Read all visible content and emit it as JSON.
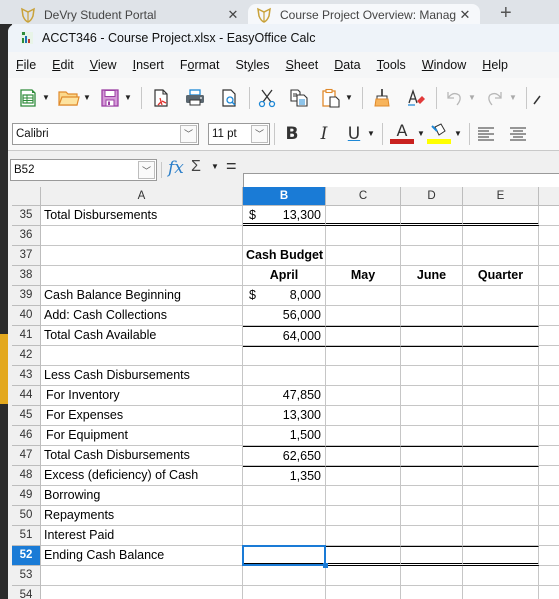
{
  "browser": {
    "tabs": [
      {
        "label": "DeVry Student Portal",
        "icon": "devry-shield-icon",
        "active": false
      },
      {
        "label": "Course Project Overview: Manage",
        "icon": "devry-shield-icon",
        "active": true
      }
    ],
    "new_tab_label": "+",
    "close_glyph": "✕"
  },
  "app": {
    "title": "ACCT346 - Course Project.xlsx - EasyOffice Calc",
    "menu": [
      {
        "label": "File",
        "accel": "F",
        "rest": "ile"
      },
      {
        "label": "Edit",
        "accel": "E",
        "rest": "dit"
      },
      {
        "label": "View",
        "accel": "V",
        "rest": "iew"
      },
      {
        "label": "Insert",
        "accel": "I",
        "rest": "nsert"
      },
      {
        "label": "Format",
        "pre": "F",
        "accel": "o",
        "rest": "rmat"
      },
      {
        "label": "Styles",
        "pre": "St",
        "accel": "y",
        "rest": "les"
      },
      {
        "label": "Sheet",
        "accel": "S",
        "rest": "heet"
      },
      {
        "label": "Data",
        "accel": "D",
        "rest": "ata"
      },
      {
        "label": "Tools",
        "accel": "T",
        "rest": "ools"
      },
      {
        "label": "Window",
        "accel": "W",
        "rest": "indow"
      },
      {
        "label": "Help",
        "accel": "H",
        "rest": "elp"
      }
    ],
    "toolbar": [
      "new-spreadsheet-icon",
      "open-folder-icon",
      "save-icon",
      "export-pdf-icon",
      "print-icon",
      "print-preview-icon",
      "cut-icon",
      "copy-icon",
      "paste-icon",
      "clone-formatting-icon",
      "clear-formatting-icon",
      "undo-icon",
      "redo-icon"
    ],
    "format": {
      "font_name": "Calibri",
      "font_size": "11 pt",
      "bold": "B",
      "italic": "I",
      "underline": "U",
      "font_color_glyph": "A",
      "font_color": "#c9211e",
      "highlight_color": "#ffff00"
    },
    "formula_bar": {
      "name_box": "B52",
      "fx": "fx",
      "sigma": "Σ",
      "equals": "=",
      "content": ""
    }
  },
  "sheet": {
    "columns": [
      "A",
      "B",
      "C",
      "D",
      "E"
    ],
    "selected_column": "B",
    "selected_cell": "B52",
    "rows": [
      {
        "num": "35",
        "a": "Total Disbursements",
        "b_cur": "$",
        "b": "13,300"
      },
      {
        "num": "36",
        "a": "",
        "b": ""
      },
      {
        "num": "37",
        "a": "",
        "b": "Cash Budget"
      },
      {
        "num": "38",
        "a": "",
        "b": "April",
        "c": "May",
        "d": "June",
        "e": "Quarter"
      },
      {
        "num": "39",
        "a": "Cash Balance Beginning",
        "b_cur": "$",
        "b": "8,000"
      },
      {
        "num": "40",
        "a": "Add: Cash Collections",
        "b": "56,000"
      },
      {
        "num": "41",
        "a": "Total Cash Available",
        "b": "64,000"
      },
      {
        "num": "42",
        "a": "",
        "b": ""
      },
      {
        "num": "43",
        "a": "Less Cash Disbursements",
        "b": ""
      },
      {
        "num": "44",
        "a": "For Inventory",
        "b": "47,850"
      },
      {
        "num": "45",
        "a": "For Expenses",
        "b": "13,300"
      },
      {
        "num": "46",
        "a": "For Equipment",
        "b": "1,500"
      },
      {
        "num": "47",
        "a": "Total Cash Disbursements",
        "b": "62,650"
      },
      {
        "num": "48",
        "a": "Excess (deficiency) of Cash",
        "b": "1,350"
      },
      {
        "num": "49",
        "a": "Borrowing",
        "b": ""
      },
      {
        "num": "50",
        "a": "Repayments",
        "b": ""
      },
      {
        "num": "51",
        "a": "Interest Paid",
        "b": ""
      },
      {
        "num": "52",
        "a": "Ending Cash Balance",
        "b": ""
      },
      {
        "num": "53",
        "a": "",
        "b": ""
      },
      {
        "num": "54",
        "a": "",
        "b": ""
      }
    ]
  },
  "colors": {
    "selection": "#1a7bd6",
    "font_color_bar": "#c9211e",
    "highlight_bar": "#ffff00"
  }
}
